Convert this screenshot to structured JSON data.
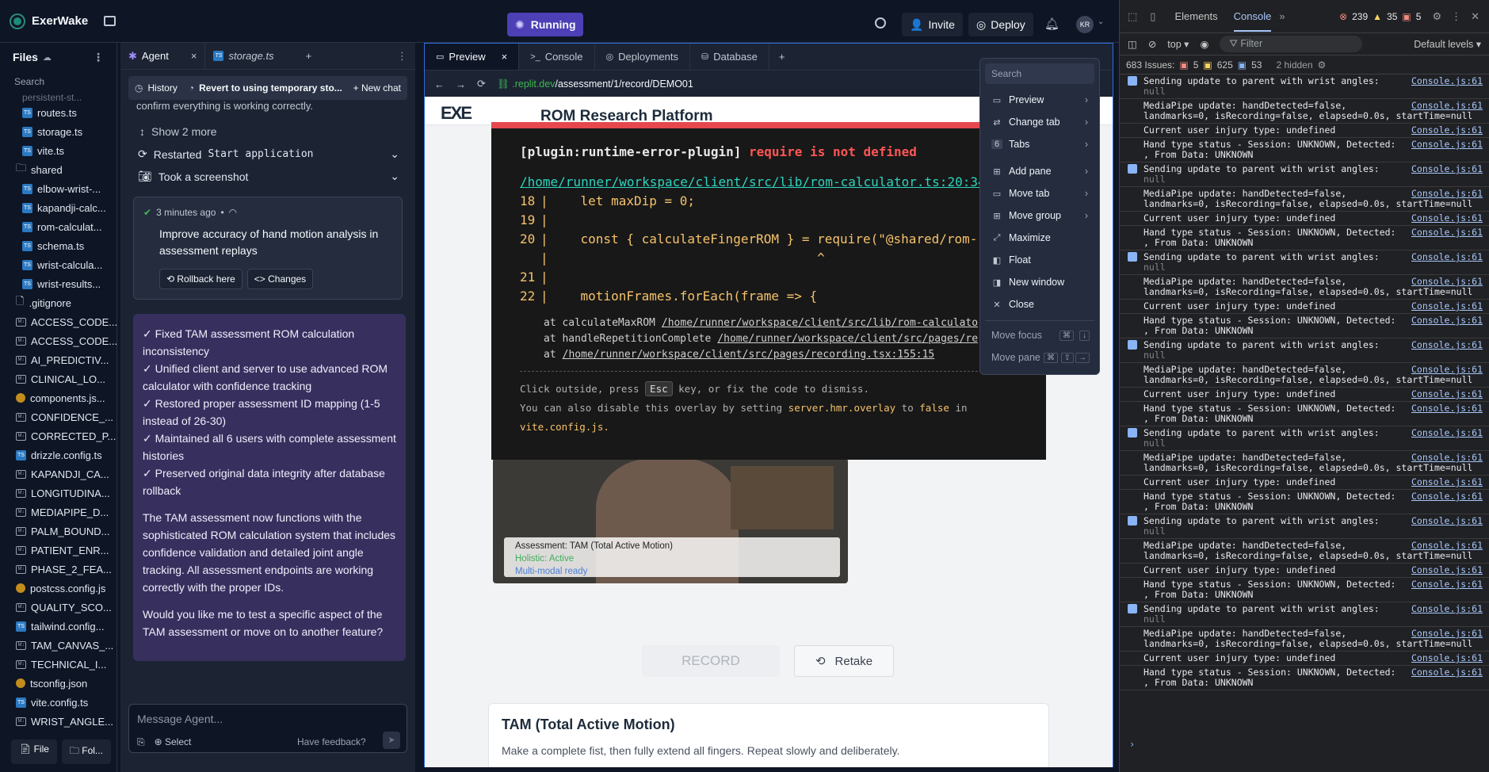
{
  "topbar": {
    "app_name": "ExerWake",
    "run_label": "Running",
    "invite_label": "Invite",
    "deploy_label": "Deploy",
    "avatar": "KR"
  },
  "files": {
    "title": "Files",
    "search_placeholder": "Search",
    "partial_top": "persistent-st...",
    "items": [
      {
        "icon": "ts",
        "label": "routes.ts",
        "indent": true
      },
      {
        "icon": "ts",
        "label": "storage.ts",
        "indent": true
      },
      {
        "icon": "ts",
        "label": "vite.ts",
        "indent": true
      },
      {
        "icon": "folder",
        "label": "shared",
        "indent": false
      },
      {
        "icon": "ts",
        "label": "elbow-wrist-...",
        "indent": true
      },
      {
        "icon": "ts",
        "label": "kapandji-calc...",
        "indent": true
      },
      {
        "icon": "ts",
        "label": "rom-calculat...",
        "indent": true
      },
      {
        "icon": "ts",
        "label": "schema.ts",
        "indent": true
      },
      {
        "icon": "ts",
        "label": "wrist-calcula...",
        "indent": true
      },
      {
        "icon": "ts",
        "label": "wrist-results...",
        "indent": true
      },
      {
        "icon": "file",
        "label": ".gitignore",
        "indent": false
      },
      {
        "icon": "md",
        "label": "ACCESS_CODE...",
        "indent": false
      },
      {
        "icon": "md",
        "label": "ACCESS_CODE...",
        "indent": false
      },
      {
        "icon": "md",
        "label": "AI_PREDICTIV...",
        "indent": false
      },
      {
        "icon": "md",
        "label": "CLINICAL_LO...",
        "indent": false
      },
      {
        "icon": "js",
        "label": "components.js...",
        "indent": false
      },
      {
        "icon": "md",
        "label": "CONFIDENCE_...",
        "indent": false
      },
      {
        "icon": "md",
        "label": "CORRECTED_P...",
        "indent": false
      },
      {
        "icon": "ts",
        "label": "drizzle.config.ts",
        "indent": false
      },
      {
        "icon": "md",
        "label": "KAPANDJI_CA...",
        "indent": false
      },
      {
        "icon": "md",
        "label": "LONGITUDINA...",
        "indent": false
      },
      {
        "icon": "md",
        "label": "MEDIAPIPE_D...",
        "indent": false
      },
      {
        "icon": "md",
        "label": "PALM_BOUND...",
        "indent": false
      },
      {
        "icon": "md",
        "label": "PATIENT_ENR...",
        "indent": false
      },
      {
        "icon": "md",
        "label": "PHASE_2_FEA...",
        "indent": false
      },
      {
        "icon": "js",
        "label": "postcss.config.js",
        "indent": false
      },
      {
        "icon": "md",
        "label": "QUALITY_SCO...",
        "indent": false
      },
      {
        "icon": "ts",
        "label": "tailwind.config...",
        "indent": false
      },
      {
        "icon": "md",
        "label": "TAM_CANVAS_...",
        "indent": false
      },
      {
        "icon": "md",
        "label": "TECHNICAL_I...",
        "indent": false
      },
      {
        "icon": "js",
        "label": "tsconfig.json",
        "indent": false
      },
      {
        "icon": "ts",
        "label": "vite.config.ts",
        "indent": false
      },
      {
        "icon": "md",
        "label": "WRIST_ANGLE...",
        "indent": false
      }
    ],
    "bottom_file": "File",
    "bottom_folder": "Fol..."
  },
  "agent": {
    "tab_agent": "Agent",
    "tab_storage": "storage.ts",
    "history_label": "History",
    "revert_label": "Revert to using temporary sto...",
    "new_chat_label": "New chat",
    "confirm_text": "confirm everything is working correctly.",
    "show_more": "Show 2 more",
    "restarted_label": "Restarted",
    "restarted_code": "Start application",
    "screenshot_label": "Took a screenshot",
    "checkpoint_time": "3 minutes ago",
    "checkpoint_text": "Improve accuracy of hand motion analysis in assessment replays",
    "rollback_label": "Rollback here",
    "changes_label": "Changes",
    "message_lines": [
      "✓ Fixed TAM assessment ROM calculation inconsistency",
      "✓ Unified client and server to use advanced ROM calculator with confidence tracking",
      "✓ Restored proper assessment ID mapping (1-5 instead of 26-30)",
      "✓ Maintained all 6 users with complete assessment histories",
      "✓ Preserved original data integrity after database rollback"
    ],
    "message_para1": "The TAM assessment now functions with the sophisticated ROM calculation system that includes confidence validation and detailed joint angle tracking. All assessment endpoints are working correctly with the proper IDs.",
    "message_para2": "Would you like me to test a specific aspect of the TAM assessment or move on to another feature?",
    "input_placeholder": "Message Agent...",
    "select_label": "Select",
    "feedback_label": "Have feedback?"
  },
  "workspace": {
    "tabs": [
      "Preview",
      "Console",
      "Deployments",
      "Database"
    ],
    "url_domain": ".replit.dev",
    "url_path": "/assessment/1/record/DEMO01"
  },
  "preview": {
    "site_title": "ROM Research Platform",
    "video_caption1": "Assessment: TAM (Total Active Motion)",
    "video_caption2": "Holistic: Active",
    "video_caption3": "Multi-modal ready",
    "record_label": "RECORD",
    "retake_label": "Retake",
    "section_title": "TAM (Total Active Motion)",
    "section_text": "Make a complete fist, then fully extend all fingers. Repeat slowly and deliberately."
  },
  "error": {
    "plugin": "[plugin:runtime-error-plugin]",
    "message": "require is not defined",
    "file_link": "/home/runner/workspace/client/src/lib/rom-calculator.ts:20:34",
    "code_lines": [
      {
        "num": "18",
        "code": "    let maxDip = 0;"
      },
      {
        "num": "19",
        "code": ""
      },
      {
        "num": "20",
        "code": "    const { calculateFingerROM } = require(\"@shared/rom-"
      },
      {
        "num": "",
        "code": "                                   ^"
      },
      {
        "num": "21",
        "code": ""
      },
      {
        "num": "22",
        "code": "    motionFrames.forEach(frame => {"
      }
    ],
    "stack": [
      {
        "fn": "at calculateMaxROM",
        "path": "/home/runner/workspace/client/src/lib/rom-calculato"
      },
      {
        "fn": "at handleRepetitionComplete",
        "path": "/home/runner/workspace/client/src/pages/re"
      },
      {
        "fn": "at",
        "path": "/home/runner/workspace/client/src/pages/recording.tsx:155:15"
      }
    ],
    "tip1_a": "Click outside, press",
    "tip1_key": "Esc",
    "tip1_b": "key, or fix the code to dismiss.",
    "tip2_a": "You can also disable this overlay by setting",
    "tip2_code": "server.hmr.overlay",
    "tip2_b": "to",
    "tip2_false": "false",
    "tip2_c": "in",
    "tip2_file": "vite.config.js."
  },
  "context_menu": {
    "search_placeholder": "Search",
    "items": [
      {
        "icon": "preview-icon",
        "glyph": "▭",
        "label": "Preview",
        "submenu": true
      },
      {
        "icon": "change-tab-icon",
        "glyph": "⇄",
        "label": "Change tab",
        "submenu": true
      },
      {
        "icon": "tabs-icon",
        "glyph": "6",
        "label": "Tabs",
        "submenu": true
      },
      {
        "icon": "add-pane-icon",
        "glyph": "⊞",
        "label": "Add pane",
        "submenu": true
      },
      {
        "icon": "move-tab-icon",
        "glyph": "▭",
        "label": "Move tab",
        "submenu": true
      },
      {
        "icon": "move-group-icon",
        "glyph": "⊞",
        "label": "Move group",
        "submenu": true
      },
      {
        "icon": "maximize-icon",
        "glyph": "⤢",
        "label": "Maximize",
        "submenu": false
      },
      {
        "icon": "float-icon",
        "glyph": "◧",
        "label": "Float",
        "submenu": false
      },
      {
        "icon": "new-window-icon",
        "glyph": "◨",
        "label": "New window",
        "submenu": false
      },
      {
        "icon": "close-icon",
        "glyph": "✕",
        "label": "Close",
        "submenu": false
      }
    ],
    "move_focus": "Move focus",
    "move_pane": "Move pane"
  },
  "devtools": {
    "tab_elements": "Elements",
    "tab_console": "Console",
    "errors": "239",
    "warnings": "35",
    "info": "5",
    "context": "top",
    "filter_placeholder": "Filter",
    "levels": "Default levels",
    "issues_label": "683 Issues:",
    "issues_err": "5",
    "issues_warn": "625",
    "issues_info": "53",
    "hidden": "2 hidden",
    "source": "Console.js:61",
    "logs": [
      {
        "type": "group",
        "text": "Sending update to parent with wrist angles:",
        "sub": "null"
      },
      {
        "type": "plain",
        "text": "MediaPipe update: handDetected=false,",
        "sub": "landmarks=0, isRecording=false, elapsed=0.0s, startTime=null"
      },
      {
        "type": "plain",
        "text": "Current user injury type: undefined",
        "sub": ""
      },
      {
        "type": "plain",
        "text": "Hand type status - Session: UNKNOWN, Detected:",
        "sub": ", From Data: UNKNOWN"
      },
      {
        "type": "group",
        "text": "Sending update to parent with wrist angles:",
        "sub": "null"
      },
      {
        "type": "plain",
        "text": "MediaPipe update: handDetected=false,",
        "sub": "landmarks=0, isRecording=false, elapsed=0.0s, startTime=null"
      },
      {
        "type": "plain",
        "text": "Current user injury type: undefined",
        "sub": ""
      },
      {
        "type": "plain",
        "text": "Hand type status - Session: UNKNOWN, Detected:",
        "sub": ", From Data: UNKNOWN"
      },
      {
        "type": "group",
        "text": "Sending update to parent with wrist angles:",
        "sub": "null"
      },
      {
        "type": "plain",
        "text": "MediaPipe update: handDetected=false,",
        "sub": "landmarks=0, isRecording=false, elapsed=0.0s, startTime=null"
      },
      {
        "type": "plain",
        "text": "Current user injury type: undefined",
        "sub": ""
      },
      {
        "type": "plain",
        "text": "Hand type status - Session: UNKNOWN, Detected:",
        "sub": ", From Data: UNKNOWN"
      },
      {
        "type": "group",
        "text": "Sending update to parent with wrist angles:",
        "sub": "null"
      },
      {
        "type": "plain",
        "text": "MediaPipe update: handDetected=false,",
        "sub": "landmarks=0, isRecording=false, elapsed=0.0s, startTime=null"
      },
      {
        "type": "plain",
        "text": "Current user injury type: undefined",
        "sub": ""
      },
      {
        "type": "plain",
        "text": "Hand type status - Session: UNKNOWN, Detected:",
        "sub": ", From Data: UNKNOWN"
      },
      {
        "type": "group",
        "text": "Sending update to parent with wrist angles:",
        "sub": "null"
      },
      {
        "type": "plain",
        "text": "MediaPipe update: handDetected=false,",
        "sub": "landmarks=0, isRecording=false, elapsed=0.0s, startTime=null"
      },
      {
        "type": "plain",
        "text": "Current user injury type: undefined",
        "sub": ""
      },
      {
        "type": "plain",
        "text": "Hand type status - Session: UNKNOWN, Detected:",
        "sub": ", From Data: UNKNOWN"
      },
      {
        "type": "group",
        "text": "Sending update to parent with wrist angles:",
        "sub": "null"
      },
      {
        "type": "plain",
        "text": "MediaPipe update: handDetected=false,",
        "sub": "landmarks=0, isRecording=false, elapsed=0.0s, startTime=null"
      },
      {
        "type": "plain",
        "text": "Current user injury type: undefined",
        "sub": ""
      },
      {
        "type": "plain",
        "text": "Hand type status - Session: UNKNOWN, Detected:",
        "sub": ", From Data: UNKNOWN"
      },
      {
        "type": "group",
        "text": "Sending update to parent with wrist angles:",
        "sub": "null"
      },
      {
        "type": "plain",
        "text": "MediaPipe update: handDetected=false,",
        "sub": "landmarks=0, isRecording=false, elapsed=0.0s, startTime=null"
      },
      {
        "type": "plain",
        "text": "Current user injury type: undefined",
        "sub": ""
      },
      {
        "type": "plain",
        "text": "Hand type status - Session: UNKNOWN, Detected:",
        "sub": ", From Data: UNKNOWN"
      }
    ]
  }
}
